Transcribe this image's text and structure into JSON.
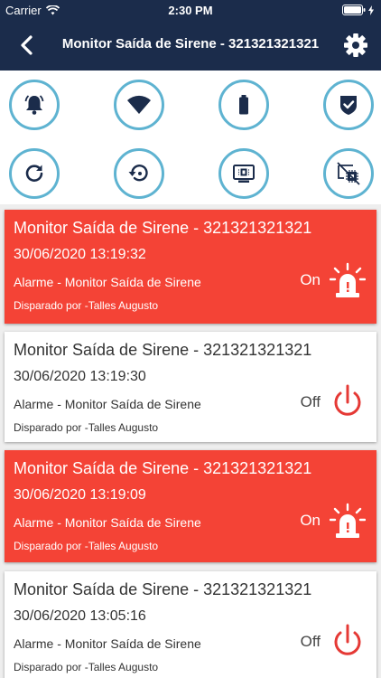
{
  "status_bar": {
    "carrier": "Carrier",
    "time": "2:30 PM"
  },
  "nav": {
    "title": "Monitor Saída de Sirene - 321321321321",
    "back_icon": "back-chevron-icon",
    "settings_icon": "gear-icon"
  },
  "actions": [
    {
      "icon": "bell-alarm-icon"
    },
    {
      "icon": "wifi-icon"
    },
    {
      "icon": "battery-icon"
    },
    {
      "icon": "shield-check-icon"
    },
    {
      "icon": "refresh-icon"
    },
    {
      "icon": "restore-icon"
    },
    {
      "icon": "monitor-chip-icon"
    },
    {
      "icon": "monitor-chip-off-icon"
    }
  ],
  "events": [
    {
      "title": "Monitor Saída de Sirene - 321321321321",
      "datetime": "30/06/2020  13:19:32",
      "type": "Alarme - Monitor Saída de Sirene",
      "by": "Disparado por -Talles Augusto",
      "state": "On",
      "style": "alarm",
      "icon": "siren-icon"
    },
    {
      "title": "Monitor Saída de Sirene - 321321321321",
      "datetime": "30/06/2020  13:19:30",
      "type": "Alarme - Monitor Saída de Sirene",
      "by": "Disparado por -Talles Augusto",
      "state": "Off",
      "style": "normal",
      "icon": "power-icon"
    },
    {
      "title": "Monitor Saída de Sirene - 321321321321",
      "datetime": "30/06/2020  13:19:09",
      "type": "Alarme - Monitor Saída de Sirene",
      "by": "Disparado por -Talles Augusto",
      "state": "On",
      "style": "alarm",
      "icon": "siren-icon"
    },
    {
      "title": "Monitor Saída de Sirene - 321321321321",
      "datetime": "30/06/2020  13:05:16",
      "type": "Alarme - Monitor Saída de Sirene",
      "by": "Disparado por -Talles Augusto",
      "state": "Off",
      "style": "normal",
      "icon": "power-icon"
    }
  ],
  "colors": {
    "nav_bg": "#1b2c4b",
    "alarm_bg": "#f44336",
    "ring": "#5eb3d1",
    "icon_dark": "#1b2c4b",
    "power_red": "#e53935"
  }
}
